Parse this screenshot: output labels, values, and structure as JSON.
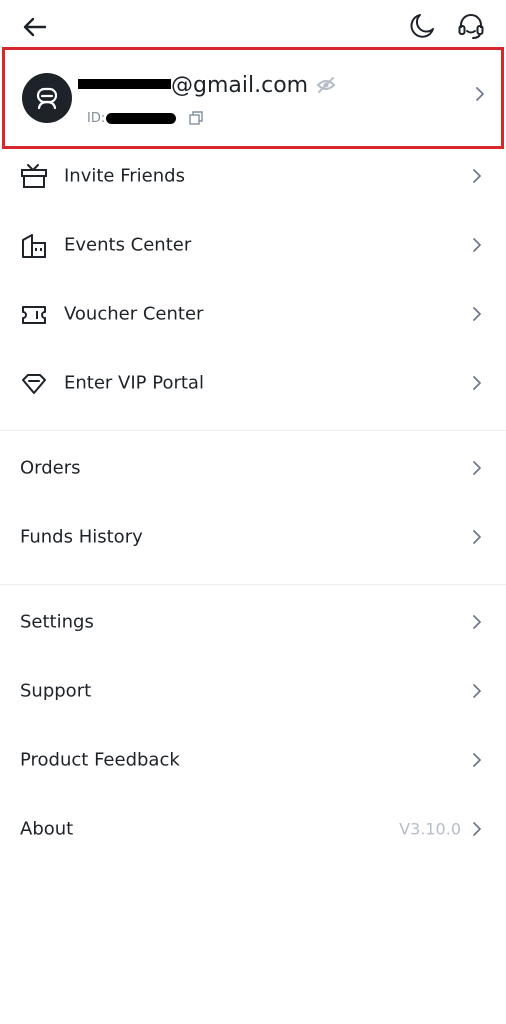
{
  "header": {
    "back_icon": "arrow-left-icon",
    "theme_icon": "moon-icon",
    "support_icon": "headset-icon"
  },
  "profile": {
    "email": "@gmail.com",
    "id_label": "ID:",
    "highlight_color": "#d7262c"
  },
  "menu_group_1": [
    {
      "label": "Invite Friends",
      "icon": "gift-box-icon"
    },
    {
      "label": "Events Center",
      "icon": "building-icon"
    },
    {
      "label": "Voucher Center",
      "icon": "ticket-icon"
    },
    {
      "label": "Enter VIP Portal",
      "icon": "diamond-icon"
    }
  ],
  "menu_group_2": [
    {
      "label": "Orders"
    },
    {
      "label": "Funds History"
    }
  ],
  "menu_group_3": [
    {
      "label": "Settings"
    },
    {
      "label": "Support"
    },
    {
      "label": "Product Feedback"
    },
    {
      "label": "About",
      "value": "V3.10.0"
    }
  ]
}
